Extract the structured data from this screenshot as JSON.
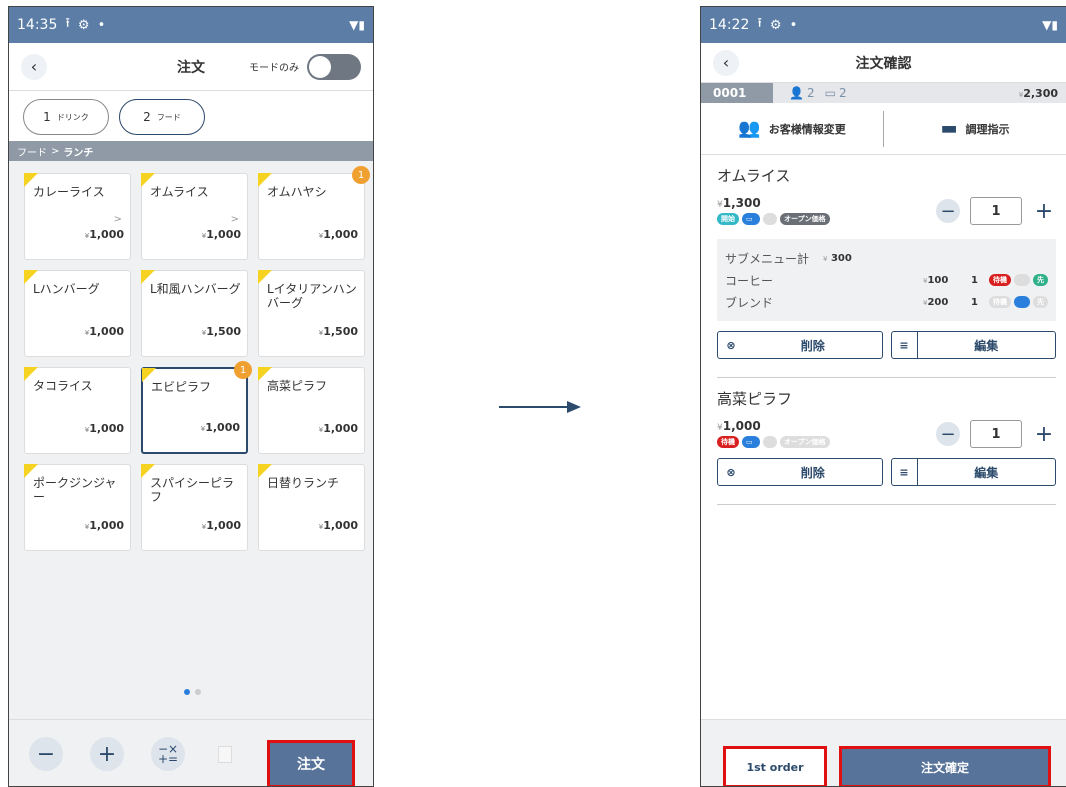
{
  "left": {
    "status": {
      "time": "14:35",
      "icons": [
        "upload-icon",
        "settings-icon",
        "dot-icon"
      ]
    },
    "header": {
      "title": "注文",
      "mode_label": "モードのみ"
    },
    "tabs": [
      {
        "num": "1",
        "label": "ドリンク"
      },
      {
        "num": "2",
        "label": "フード"
      }
    ],
    "breadcrumb": {
      "parent": "フード",
      "sep": ">",
      "current": "ランチ"
    },
    "items": [
      {
        "name": "カレーライス",
        "price": "1,000",
        "arrow": ">"
      },
      {
        "name": "オムライス",
        "price": "1,000",
        "arrow": ">"
      },
      {
        "name": "オムハヤシ",
        "price": "1,000",
        "badge": "1"
      },
      {
        "name": "Lハンバーグ",
        "price": "1,000"
      },
      {
        "name": "L和風ハンバーグ",
        "price": "1,500"
      },
      {
        "name": "Lイタリアンハンバーグ",
        "price": "1,500"
      },
      {
        "name": "タコライス",
        "price": "1,000"
      },
      {
        "name": "エビピラフ",
        "price": "1,000",
        "badge": "1"
      },
      {
        "name": "高菜ピラフ",
        "price": "1,000"
      },
      {
        "name": "ポークジンジャー",
        "price": "1,000"
      },
      {
        "name": "スパイシーピラフ",
        "price": "1,000"
      },
      {
        "name": "日替りランチ",
        "price": "1,000"
      }
    ],
    "currency": "¥",
    "order_button": "注文"
  },
  "right": {
    "status": {
      "time": "14:22"
    },
    "header": {
      "title": "注文確認"
    },
    "info": {
      "order_no": "0001",
      "people": "2",
      "seats": "2",
      "currency": "¥",
      "total": "2,300"
    },
    "actions": {
      "customer": "お客様情報変更",
      "cooking": "調理指示"
    },
    "order_items": [
      {
        "name": "オムライス",
        "currency": "¥",
        "price": "1,300",
        "qty": "1",
        "tags": [
          "開始",
          "",
          "",
          "オープン価格"
        ],
        "subtotal_label": "サブメニュー計",
        "subtotal": "300",
        "subs": [
          {
            "name": "コーヒー",
            "price": "100",
            "qty": "1",
            "t1": "待機",
            "t2": "",
            "t3": "先"
          },
          {
            "name": "ブレンド",
            "price": "200",
            "qty": "1",
            "t1": "待機",
            "t2": "",
            "t3": "先"
          }
        ],
        "delete": "削除",
        "edit": "編集"
      },
      {
        "name": "高菜ピラフ",
        "currency": "¥",
        "price": "1,000",
        "qty": "1",
        "tags": [
          "待機",
          "",
          "",
          "オープン価格"
        ],
        "delete": "削除",
        "edit": "編集"
      }
    ],
    "first_order": "1st order",
    "confirm": "注文確定"
  },
  "colors": {
    "primary": "#58739a",
    "statusbar": "#5b7da6",
    "highlight": "#e01010",
    "badge": "#f0a030",
    "corner": "#f5d320"
  }
}
